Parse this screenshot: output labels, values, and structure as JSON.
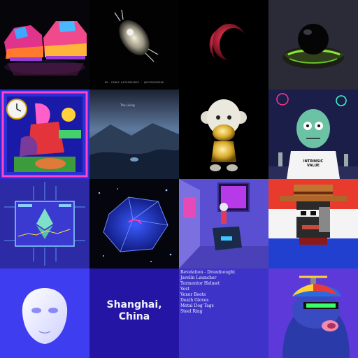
{
  "tiles": [
    {
      "name": "sneakers",
      "bg": "#06060a"
    },
    {
      "name": "microorganism",
      "bg": "#020202",
      "caption": "MS. PANOS KATOPODADOS - @MICROZOOPOD"
    },
    {
      "name": "crimson-crescent",
      "bg": "#000000"
    },
    {
      "name": "black-orb-on-pillow",
      "bg": "#2b2b38"
    },
    {
      "name": "ornate-woman-illustration",
      "bg": "#2b2fd8"
    },
    {
      "name": "misty-landscape",
      "bg": "#1f2a3e",
      "label": "The Living"
    },
    {
      "name": "gold-monkey-figure",
      "bg": "#000000"
    },
    {
      "name": "zombie-character",
      "bg": "#1c1e4a",
      "shirt_text": "INTRINSIC VALUE"
    },
    {
      "name": "ethereum-circuit",
      "bg": "#2d2aa6"
    },
    {
      "name": "sparkling-gem",
      "bg": "#04050d"
    },
    {
      "name": "gallery-room",
      "bg": "#5a4fd0"
    },
    {
      "name": "pixel-cowboy",
      "bg": "#e83a2d"
    },
    {
      "name": "white-mask",
      "bg": "#3e3df0"
    },
    {
      "name": "location-card",
      "bg": "#2415a4",
      "city": "Shanghai,\nChina"
    },
    {
      "name": "item-list",
      "bg": "#3d33c9",
      "items": [
        "Revelation - Dreadnought",
        "Javelin Launcher",
        "Tormentor Helmet",
        "Vest",
        "Vexor Boots",
        "Death Gloves",
        "Metal Dog Tags",
        "Steel Ring"
      ]
    },
    {
      "name": "propeller-hat-ape",
      "bg": "#5c39d8"
    }
  ],
  "colors": {
    "accent": "#3e3df0",
    "text": "#f4f4ff"
  }
}
